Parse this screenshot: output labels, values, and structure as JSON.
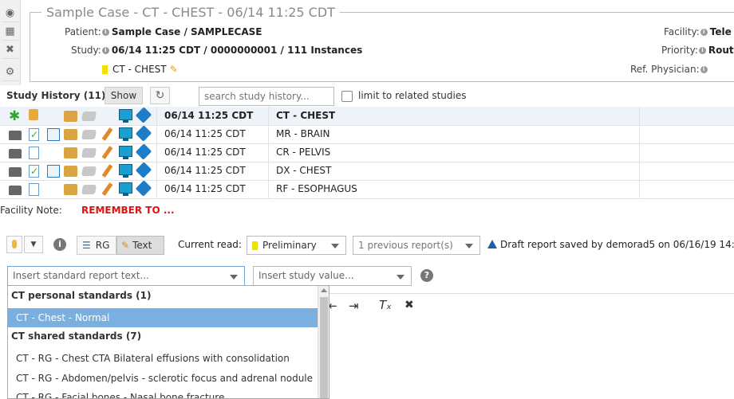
{
  "header": {
    "title": "Sample Case - CT - CHEST - 06/14 11:25 CDT",
    "patient_label": "Patient:",
    "patient_value": "Sample Case / SAMPLECASE",
    "study_label": "Study:",
    "study_value": "06/14 11:25 CDT / 0000000001 / 111 Instances",
    "modality_tag": "CT - CHEST",
    "facility_label": "Facility:",
    "facility_value": "Tele",
    "priority_label": "Priority:",
    "priority_value": "Rout",
    "ref_physician_label": "Ref. Physician:"
  },
  "study_history": {
    "title": "Study History (11)",
    "show_label": "Show",
    "search_placeholder": "search study history...",
    "limit_label": "limit to related studies",
    "rows": [
      {
        "date": "06/14 11:25 CDT",
        "study": "CT - CHEST",
        "selected": true
      },
      {
        "date": "06/14 11:25 CDT",
        "study": "MR - BRAIN"
      },
      {
        "date": "06/14 11:25 CDT",
        "study": "CR - PELVIS"
      },
      {
        "date": "06/14 11:25 CDT",
        "study": "DX - CHEST"
      },
      {
        "date": "06/14 11:25 CDT",
        "study": "RF - ESOPHAGUS"
      }
    ]
  },
  "facility_note": {
    "label": "Facility Note:",
    "value": "REMEMBER TO ..."
  },
  "report_toolbar": {
    "rg_label": "RG",
    "text_label": "Text",
    "current_read_label": "Current read:",
    "current_read_value": "Preliminary",
    "previous_reports": "1 previous report(s)",
    "draft_status": "Draft report saved by demorad5 on 06/16/19 14:"
  },
  "insert": {
    "standard_placeholder": "Insert standard report text...",
    "study_value_placeholder": "Insert study value..."
  },
  "dropdown": {
    "group1": "CT personal standards (1)",
    "group1_items": [
      "CT - Chest - Normal"
    ],
    "group2": "CT shared standards (7)",
    "group2_items": [
      "CT - RG - Chest CTA Bilateral effusions with consolidation",
      "CT - RG - Abdomen/pelvis - sclerotic focus and adrenal nodule",
      "CT - RG - Facial bones - Nasal bone fracture"
    ]
  },
  "colors": {
    "accent_red": "#dd1111",
    "highlight_blue": "#7bafe0",
    "flag_yellow": "#f2e000"
  }
}
